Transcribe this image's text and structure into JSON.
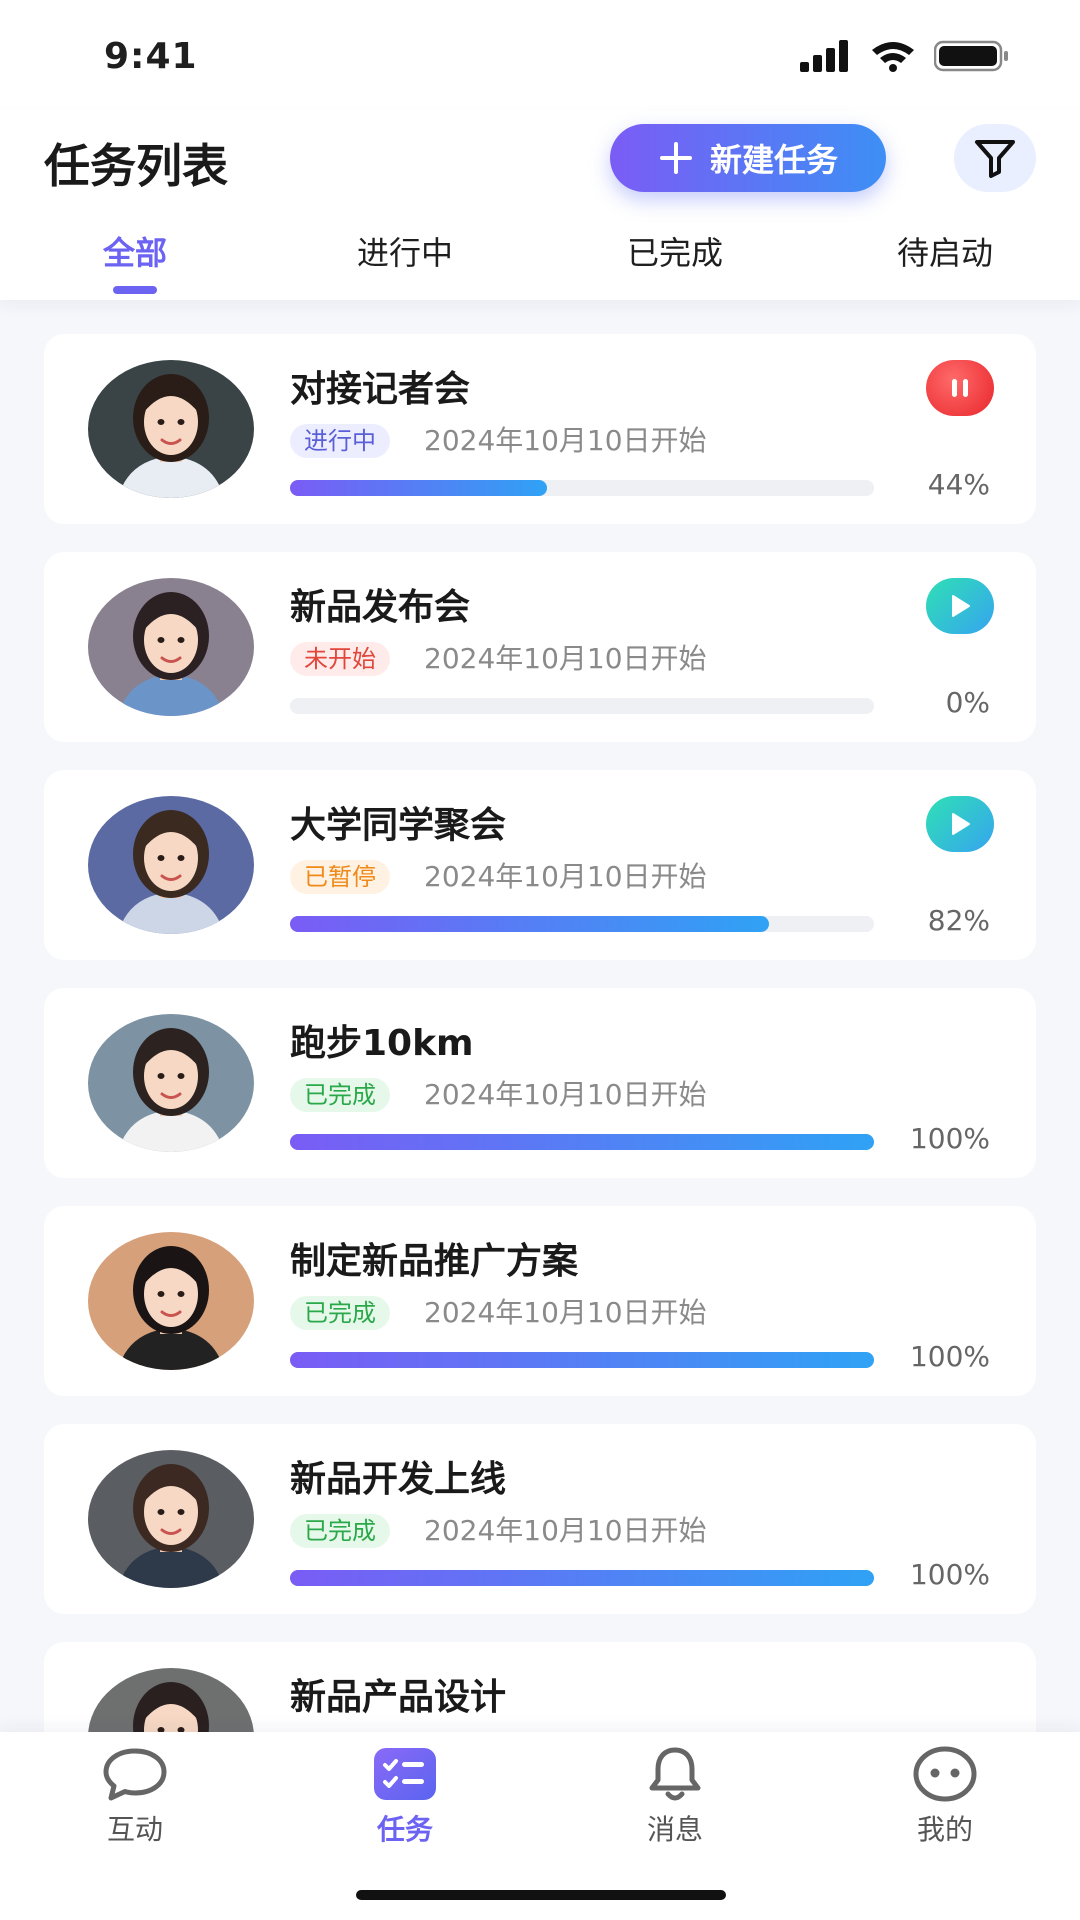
{
  "status_bar": {
    "time": "9:41"
  },
  "header": {
    "title": "任务列表",
    "new_task_label": "新建任务",
    "tabs": [
      {
        "label": "全部",
        "active": true
      },
      {
        "label": "进行中",
        "active": false
      },
      {
        "label": "已完成",
        "active": false
      },
      {
        "label": "待启动",
        "active": false
      }
    ]
  },
  "tasks": [
    {
      "title": "对接记者会",
      "status": "进行中",
      "status_color": "#5b5fd6",
      "status_bg": "#eceeff",
      "date": "2024年10月10日开始",
      "progress": 44,
      "progress_label": "44%",
      "action": "pause-icon",
      "avatar_bg": "#3a4346",
      "hair": "#2a1d17",
      "shirt": "#e8edf3"
    },
    {
      "title": "新品发布会",
      "status": "未开始",
      "status_color": "#e0463b",
      "status_bg": "#ffecea",
      "date": "2024年10月10日开始",
      "progress": 0,
      "progress_label": "0%",
      "action": "play-icon",
      "avatar_bg": "#8a8190",
      "hair": "#2b2022",
      "shirt": "#6b94c8"
    },
    {
      "title": "大学同学聚会",
      "status": "已暂停",
      "status_color": "#ef8a1a",
      "status_bg": "#fff2e2",
      "date": "2024年10月10日开始",
      "progress": 82,
      "progress_label": "82%",
      "action": "play-icon",
      "avatar_bg": "#5c6aa3",
      "hair": "#3a2a20",
      "shirt": "#ccd6e6"
    },
    {
      "title": "跑步10km",
      "status": "已完成",
      "status_color": "#2ba84a",
      "status_bg": "#e6f8ea",
      "date": "2024年10月10日开始",
      "progress": 100,
      "progress_label": "100%",
      "action": "",
      "avatar_bg": "#7d93a3",
      "hair": "#2c2220",
      "shirt": "#f2f2f2"
    },
    {
      "title": "制定新品推广方案",
      "status": "已完成",
      "status_color": "#2ba84a",
      "status_bg": "#e6f8ea",
      "date": "2024年10月10日开始",
      "progress": 100,
      "progress_label": "100%",
      "action": "",
      "avatar_bg": "#d6a07a",
      "hair": "#1a1414",
      "shirt": "#222222"
    },
    {
      "title": "新品开发上线",
      "status": "已完成",
      "status_color": "#2ba84a",
      "status_bg": "#e6f8ea",
      "date": "2024年10月10日开始",
      "progress": 100,
      "progress_label": "100%",
      "action": "",
      "avatar_bg": "#5a5d62",
      "hair": "#3c2a22",
      "shirt": "#2e3a4a"
    },
    {
      "title": "新品产品设计",
      "status": "",
      "status_color": "#2ba84a",
      "status_bg": "#e6f8ea",
      "date": "",
      "progress": 0,
      "progress_label": "",
      "action": "",
      "avatar_bg": "#6e7070",
      "hair": "#2a2020",
      "shirt": "#444444"
    }
  ],
  "bottom_nav": [
    {
      "label": "互动",
      "icon": "chat-bubble-icon",
      "active": false
    },
    {
      "label": "任务",
      "icon": "task-list-icon",
      "active": true
    },
    {
      "label": "消息",
      "icon": "bell-icon",
      "active": false
    },
    {
      "label": "我的",
      "icon": "smiley-face-icon",
      "active": false
    }
  ]
}
